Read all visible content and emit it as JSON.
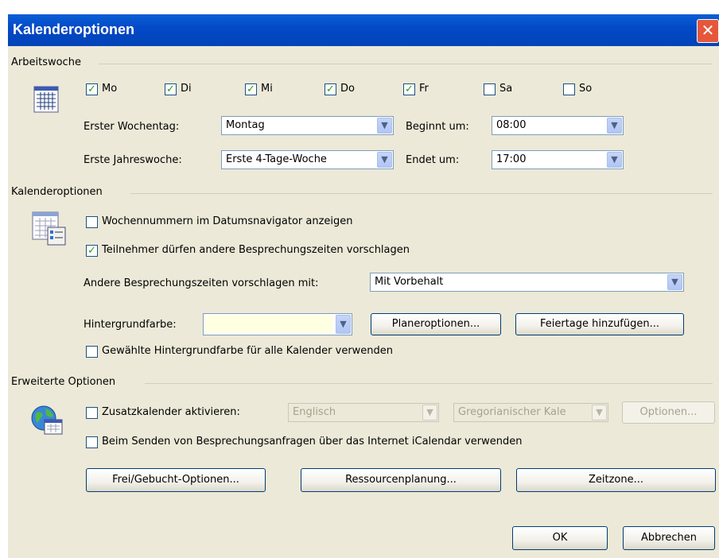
{
  "window": {
    "title": "Kalenderoptionen",
    "close_glyph": "✕"
  },
  "arbeitswoche": {
    "title": "Arbeitswoche",
    "days": [
      {
        "label": "Mo",
        "checked": true
      },
      {
        "label": "Di",
        "checked": true
      },
      {
        "label": "Mi",
        "checked": true
      },
      {
        "label": "Do",
        "checked": true
      },
      {
        "label": "Fr",
        "checked": true
      },
      {
        "label": "Sa",
        "checked": false
      },
      {
        "label": "So",
        "checked": false
      }
    ],
    "first_weekday_label": "Erster Wochentag:",
    "first_weekday_value": "Montag",
    "start_label": "Beginnt um:",
    "start_value": "08:00",
    "first_week_label": "Erste Jahreswoche:",
    "first_week_value": "Erste 4-Tage-Woche",
    "end_label": "Endet um:",
    "end_value": "17:00"
  },
  "kalenderoptionen": {
    "title": "Kalenderoptionen",
    "week_numbers_label": "Wochennummern im Datumsnavigator anzeigen",
    "week_numbers_checked": false,
    "attendees_propose_label": "Teilnehmer dürfen andere Besprechungszeiten vorschlagen",
    "attendees_propose_checked": true,
    "propose_with_label": "Andere Besprechungszeiten vorschlagen mit:",
    "propose_with_value": "Mit Vorbehalt",
    "background_color_label": "Hintergrundfarbe:",
    "background_color_value": "#ffffe1",
    "planner_button": "Planeroptionen...",
    "holidays_button": "Feiertage hinzufügen...",
    "use_color_all_label": "Gewählte Hintergrundfarbe für alle Kalender verwenden",
    "use_color_all_checked": false
  },
  "erweitert": {
    "title": "Erweiterte Optionen",
    "alt_calendar_label": "Zusatzkalender aktivieren:",
    "alt_calendar_checked": false,
    "language_value": "Englisch",
    "calendar_type_value": "Gregorianischer Kale",
    "options_button": "Optionen...",
    "icalendar_label": "Beim Senden von Besprechungsanfragen über das Internet iCalendar verwenden",
    "icalendar_checked": false,
    "freebusy_button": "Frei/Gebucht-Optionen...",
    "resource_button": "Ressourcenplanung...",
    "timezone_button": "Zeitzone..."
  },
  "footer": {
    "ok_button": "OK",
    "cancel_button": "Abbrechen"
  },
  "glyphs": {
    "check": "✓",
    "dropdown_arrow": "▼"
  }
}
